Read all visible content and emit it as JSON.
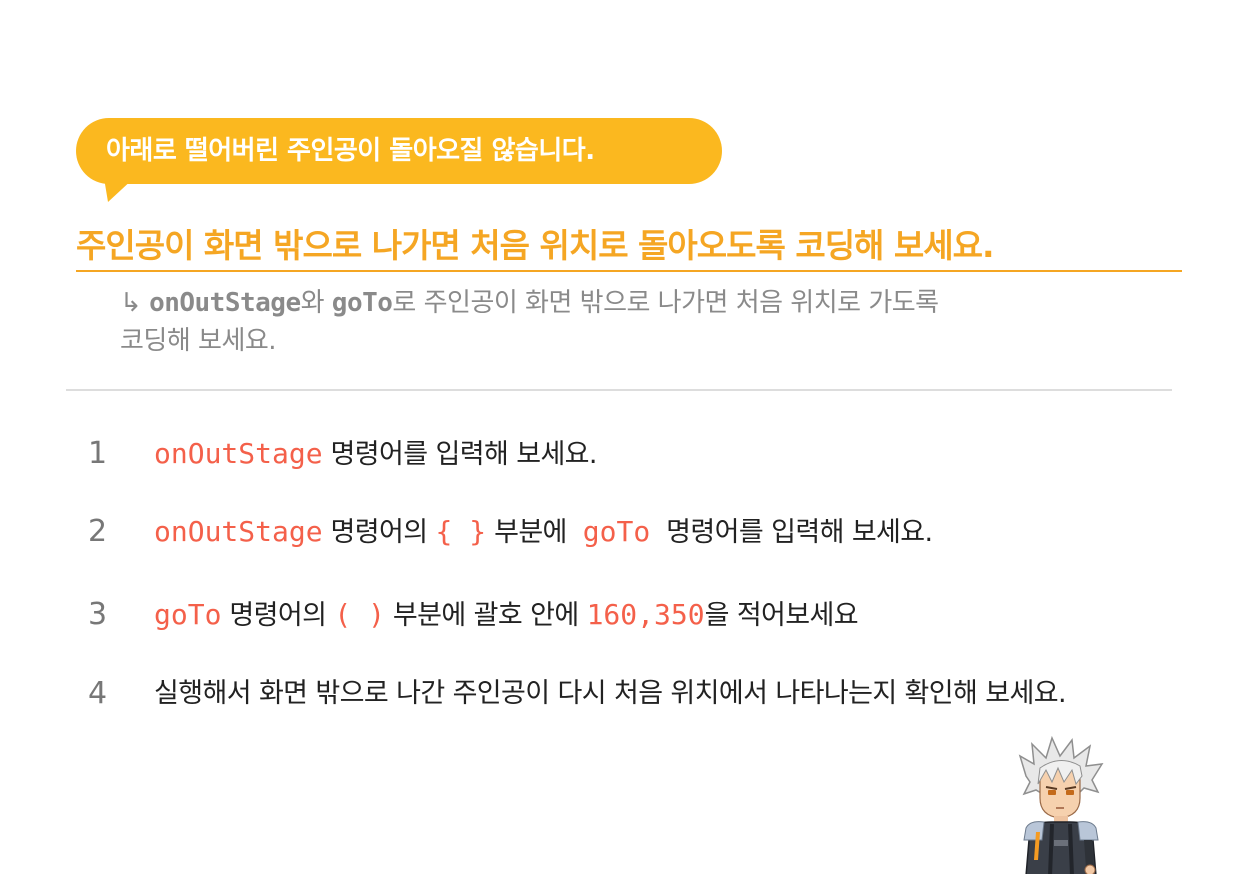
{
  "bubble": {
    "text": "아래로 떨어버린 주인공이 돌아오질 않습니다."
  },
  "heading": {
    "text": "주인공이 화면 밖으로 나가면 처음 위치로 돌아오도록 코딩해 보세요."
  },
  "subdesc": {
    "arrow": "↳",
    "code1": "onOutStage",
    "mid1": "와 ",
    "code2": "goTo",
    "line1_rest": "로 주인공이 화면 밖으로 나가면 처음 위치로 가도록",
    "line2": "코딩해 보세요."
  },
  "steps": [
    {
      "num": "1",
      "code": "onOutStage",
      "text": " 명령어를 입력해 보세요."
    },
    {
      "num": "2",
      "code": "onOutStage",
      "text_a": " 명령어의 ",
      "code_b": "{ }",
      "text_b": " 부분에  ",
      "code_c": "goTo",
      "text_c": "  명령어를 입력해 보세요."
    },
    {
      "num": "3",
      "code": "goTo",
      "text_a": " 명령어의 ",
      "code_b": "( )",
      "text_b": " 부분에 괄호 안에 ",
      "code_c": "160,350",
      "text_c": "을 적어보세요"
    },
    {
      "num": "4",
      "text": "실행해서 화면 밖으로 나간 주인공이 다시 처음 위치에서 나타나는지 확인해 보세요."
    }
  ],
  "colors": {
    "accent": "#fbb81f",
    "heading": "#f5a623",
    "code": "#f4604a"
  },
  "icons": {
    "hero": "character-hero-icon"
  }
}
